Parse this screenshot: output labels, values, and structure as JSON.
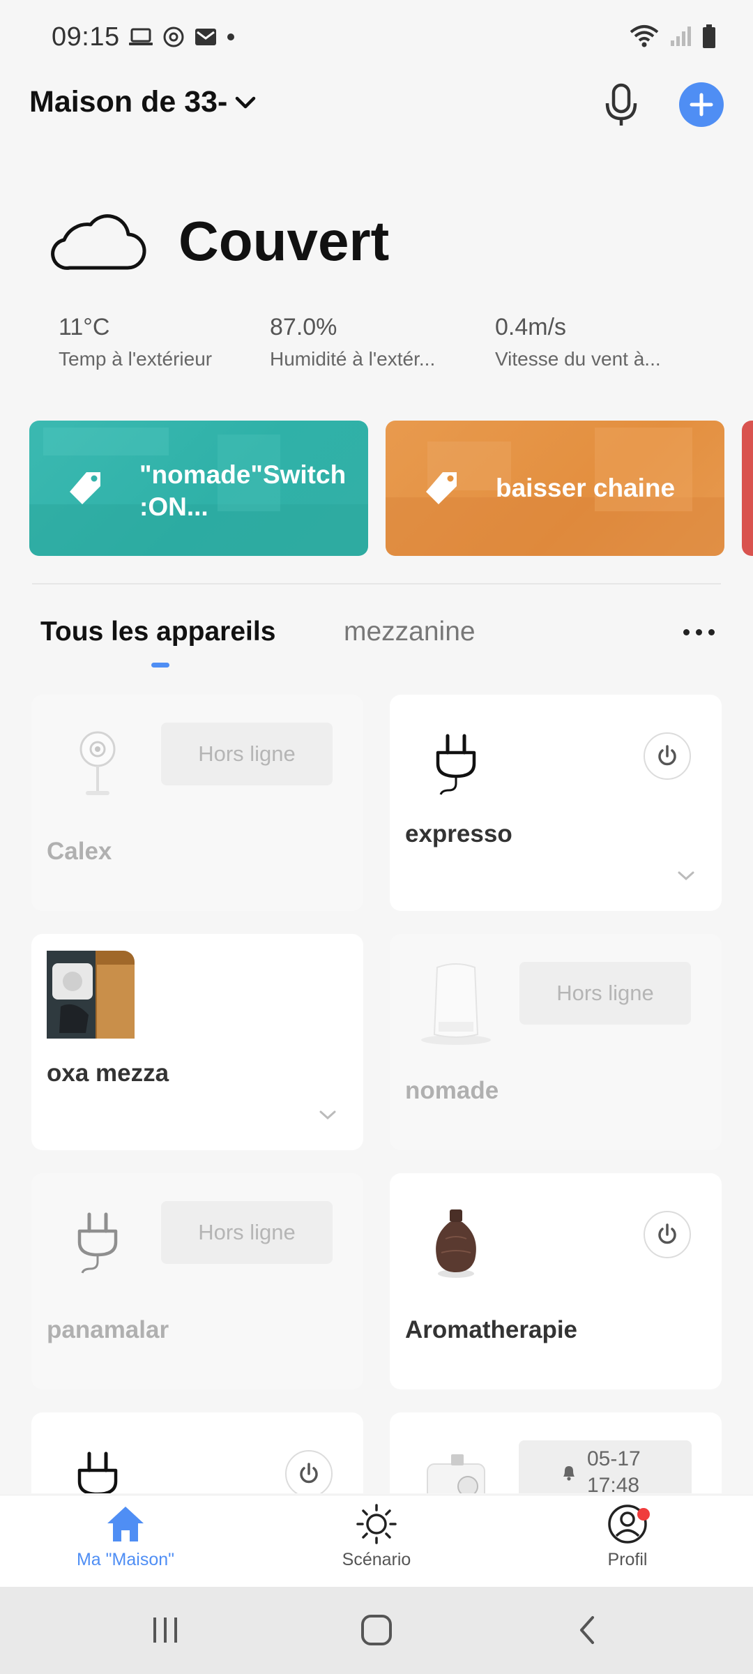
{
  "status_bar": {
    "time": "09:15",
    "icons_left": [
      "laptop-icon",
      "sync-icon",
      "mail-icon",
      "dot-icon"
    ],
    "icons_right": [
      "wifi-icon",
      "signal-icon",
      "battery-icon"
    ]
  },
  "header": {
    "home_name": "Maison de 33-",
    "mic_icon": "microphone-icon",
    "add_icon": "plus-icon",
    "accent_color": "#4f8ef4"
  },
  "weather": {
    "condition": "Couvert",
    "icon": "cloud-icon",
    "stats": [
      {
        "value": "11°C",
        "label": "Temp à l'extérieur"
      },
      {
        "value": "87.0%",
        "label": "Humidité à l'extér..."
      },
      {
        "value": "0.4m/s",
        "label": "Vitesse du vent à..."
      }
    ]
  },
  "scenes": [
    {
      "line1": "\"nomade\"Switch",
      "line2": ":ON...",
      "color": "#33b3aa",
      "icon": "tag-icon"
    },
    {
      "line1": "baisser chaine",
      "line2": "",
      "color": "#e5933f",
      "icon": "tag-icon"
    },
    {
      "line1": "",
      "line2": "",
      "color": "#d9534f",
      "icon": ""
    }
  ],
  "tabs": {
    "all": "Tous les appareils",
    "mezzanine": "mezzanine",
    "more_icon": "more-horizontal-icon"
  },
  "devices": [
    {
      "name": "Calex",
      "status": "Hors ligne",
      "icon": "camera-icon",
      "online": false
    },
    {
      "name": "expresso",
      "status": "",
      "icon": "plug-icon",
      "online": true
    },
    {
      "name": "oxa mezza",
      "status": "",
      "icon": "socket-photo-icon",
      "online": true
    },
    {
      "name": "nomade",
      "status": "Hors ligne",
      "icon": "humidifier-icon",
      "online": false
    },
    {
      "name": "panamalar",
      "status": "Hors ligne",
      "icon": "plug-icon",
      "online": false
    },
    {
      "name": "Aromatherapie",
      "status": "",
      "icon": "diffuser-icon",
      "online": true
    },
    {
      "name": "",
      "status": "",
      "icon": "plug-icon",
      "online": true
    },
    {
      "name": "",
      "schedule_date": "05-17",
      "schedule_time": "17:48",
      "icon": "lamp-icon",
      "online": true
    }
  ],
  "bottom_nav": {
    "home": "Ma \"Maison\"",
    "scenario": "Scénario",
    "profile": "Profil"
  }
}
